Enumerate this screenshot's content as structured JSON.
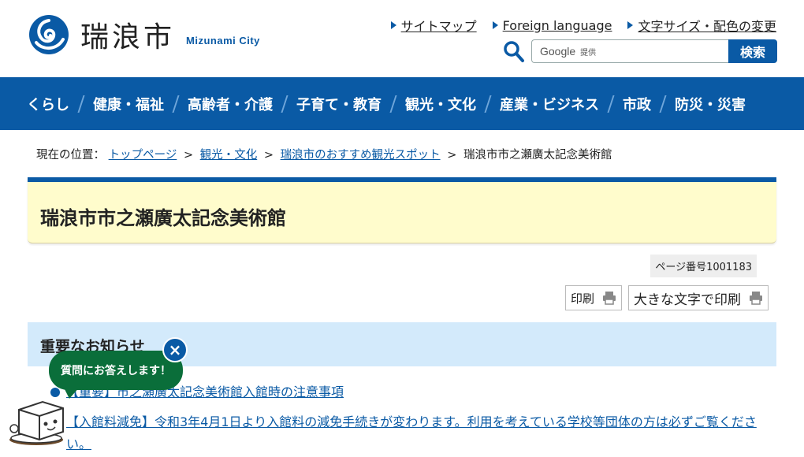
{
  "site": {
    "name_jp": "瑞浪市",
    "name_en": "Mizunami City"
  },
  "utility_links": [
    {
      "label": "サイトマップ"
    },
    {
      "label": "Foreign language"
    },
    {
      "label": "文字サイズ・配色の変更"
    }
  ],
  "search": {
    "google_label": "Google",
    "provided_label": "提供",
    "button_label": "検索"
  },
  "nav": [
    {
      "label": "くらし"
    },
    {
      "label": "健康・福祉"
    },
    {
      "label": "高齢者・介護"
    },
    {
      "label": "子育て・教育"
    },
    {
      "label": "観光・文化"
    },
    {
      "label": "産業・ビジネス"
    },
    {
      "label": "市政"
    },
    {
      "label": "防災・災害"
    }
  ],
  "breadcrumb": {
    "prefix": "現在の位置：",
    "links": [
      {
        "label": "トップページ"
      },
      {
        "label": "観光・文化"
      },
      {
        "label": "瑞浪市のおすすめ観光スポット"
      }
    ],
    "current": "瑞浪市市之瀬廣太記念美術館",
    "separator": ">"
  },
  "page": {
    "title": "瑞浪市市之瀬廣太記念美術館",
    "page_number": "ページ番号1001183",
    "print_label": "印刷",
    "print_large_label": "大きな文字で印刷"
  },
  "notice": {
    "heading": "重要なお知らせ",
    "items": [
      {
        "text": "【重要】市之瀬廣太記念美術館入館時の注意事項"
      },
      {
        "text": "【入館料減免】令和3年4月1日より入館料の減免手続きが変わります。利用を考えている学校等団体の方は必ずご覧ください。"
      }
    ]
  },
  "chatbot": {
    "bubble_text": "質問にお答えします！",
    "close_symbol": "×"
  },
  "colors": {
    "brand_blue": "#0a5aa5",
    "title_bg": "#fffccc",
    "notice_bg": "#d3eafb",
    "chat_green": "#0a6e3a"
  }
}
